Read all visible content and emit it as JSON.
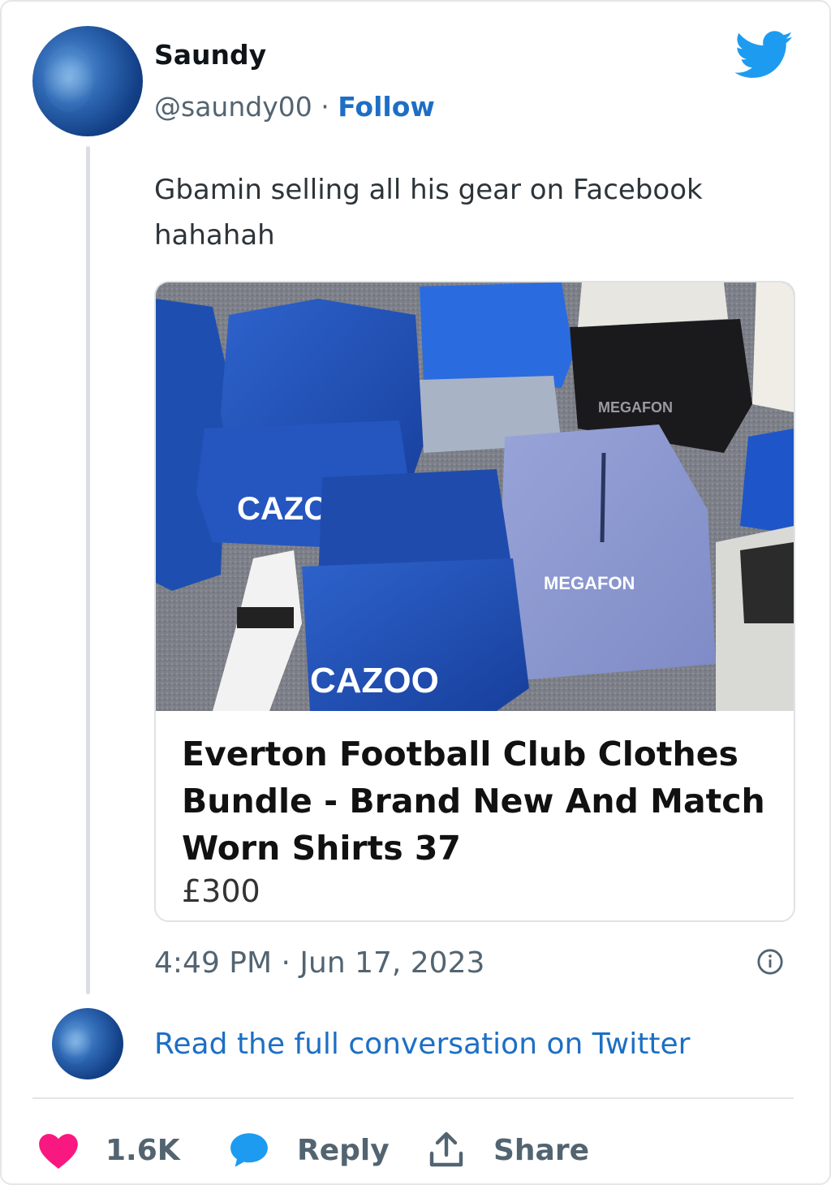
{
  "author": {
    "name": "Saundy",
    "handle": "@saundy00",
    "separator": "·",
    "follow_label": "Follow"
  },
  "tweet": {
    "text_line1": "Gbamin selling all his gear on Facebook",
    "text_line2": "hahahah"
  },
  "embed": {
    "title": "Everton Football Club Clothes Bundle - Brand New And Match Worn Shirts 37",
    "price": "£300",
    "photo_text": {
      "sponsor_left_top": "CAZOO",
      "sponsor_bottom": "CAZOO",
      "megafon_black": "MEGAFON",
      "megafon_grey": "MEGAFON"
    }
  },
  "meta": {
    "timestamp": "4:49 PM · Jun 17, 2023"
  },
  "footer": {
    "read_link": "Read the full conversation on Twitter",
    "likes": "1.6K",
    "reply_label": "Reply",
    "share_label": "Share"
  },
  "colors": {
    "brand_blue": "#1d9bf0",
    "link_blue": "#1d6fc4",
    "heart": "#f91880",
    "muted": "#536471",
    "everton_blue": "#1f4fb4"
  },
  "icons": [
    "twitter-bird-icon",
    "info-icon",
    "heart-icon",
    "reply-bubble-icon",
    "share-icon"
  ]
}
